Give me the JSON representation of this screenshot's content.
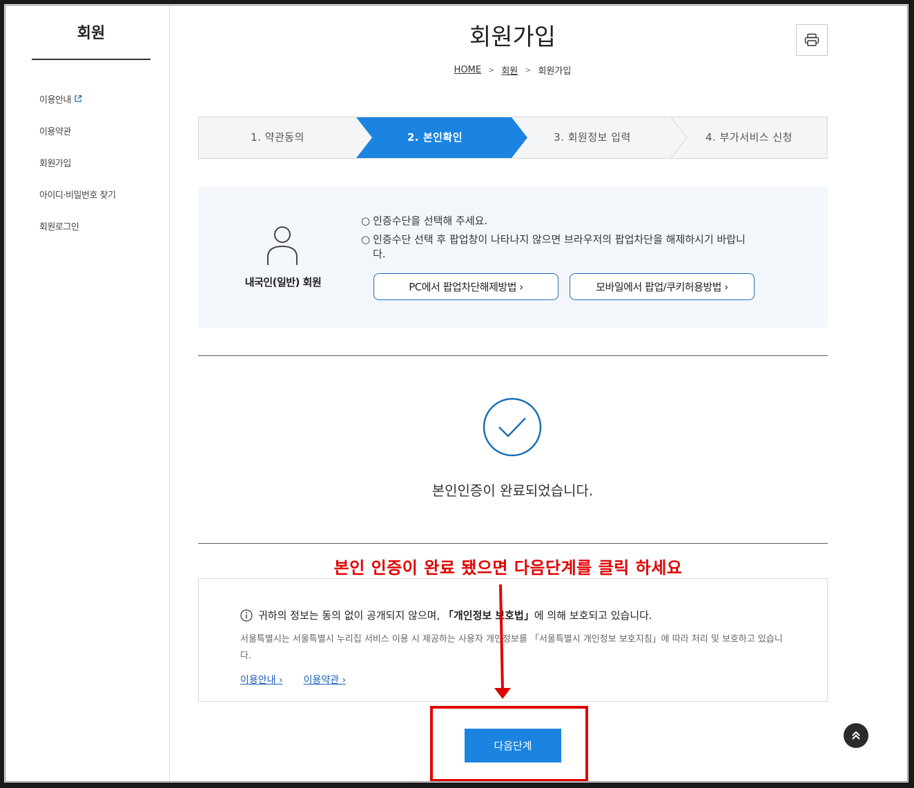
{
  "sidebar": {
    "title": "회원",
    "items": [
      {
        "label": "이용안내"
      },
      {
        "label": "이용약관"
      },
      {
        "label": "회원가입"
      },
      {
        "label": "아이디·비밀번호 찾기"
      },
      {
        "label": "회원로그인"
      }
    ]
  },
  "header": {
    "title": "회원가입",
    "breadcrumb": [
      "HOME",
      "회원",
      "회원가입"
    ]
  },
  "steps": [
    {
      "label": "1. 약관동의",
      "active": false
    },
    {
      "label": "2. 본인확인",
      "active": true
    },
    {
      "label": "3. 회원정보 입력",
      "active": false
    },
    {
      "label": "4. 부가서비스 신청",
      "active": false
    }
  ],
  "verify": {
    "member_type": "내국인(일반) 회원",
    "notices": [
      "인증수단을 선택해 주세요.",
      "인증수단 선택 후 팝업창이 나타나지 않으면 브라우저의 팝업차단을 해제하시기 바랍니다."
    ],
    "bullet": "○",
    "pc_button": "PC에서 팝업차단해제방법 ›",
    "mobile_button": "모바일에서 팝업/쿠키허용방법 ›"
  },
  "complete_message": "본인인증이 완료되었습니다.",
  "annotation": "본인 인증이 완료 됐으면 다음단계를 클릭 하세요",
  "privacy": {
    "main_before": "귀하의 정보는 동의 없이 공개되지 않으며,",
    "main_bold": "「개인정보 보호법」",
    "main_after": "에 의해 보호되고 있습니다.",
    "sub": "서울특별시는 서울특별시 누리집 서비스 이용 시 제공하는 사용자 개인정보를 「서울특별시 개인정보 보호지침」에 따라 처리 및 보호하고 있습니다.",
    "links": [
      "이용안내 ›",
      "이용약관 ›"
    ]
  },
  "next_button": "다음단계",
  "colors": {
    "accent": "#1b84e0",
    "annotation_red": "#e00000",
    "step_bg": "#f4f5f7",
    "verify_bg": "#f3f7fc"
  }
}
